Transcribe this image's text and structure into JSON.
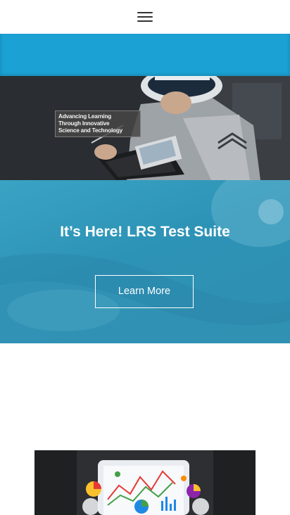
{
  "header": {
    "menu_icon": "hamburger-menu-icon"
  },
  "hero": {
    "caption_lines": [
      "Advancing Learning",
      "Through Innovative",
      "Science and Technology"
    ]
  },
  "promo": {
    "title": "It’s Here! LRS Test Suite",
    "button_label": "Learn More"
  },
  "colors": {
    "accent": "#1ba1d4",
    "promo_overlay": "#2f94b8"
  }
}
